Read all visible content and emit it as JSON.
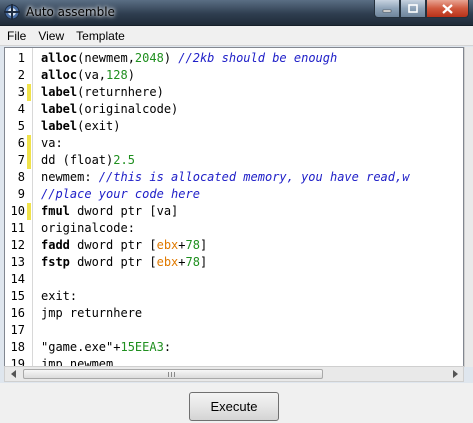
{
  "window": {
    "title": "Auto assemble",
    "icon": "cheat-engine-icon",
    "controls": [
      "minimize-icon",
      "maximize-icon",
      "close-icon"
    ]
  },
  "menu": [
    "File",
    "View",
    "Template"
  ],
  "editor": {
    "lines": [
      {
        "n": "1",
        "marked": false,
        "tokens": [
          {
            "t": "alloc",
            "c": "kw"
          },
          {
            "t": "(newmem,",
            "c": "str"
          },
          {
            "t": "2048",
            "c": "num"
          },
          {
            "t": ") ",
            "c": "str"
          },
          {
            "t": "//2kb should be enough",
            "c": "cmt"
          }
        ]
      },
      {
        "n": "2",
        "marked": false,
        "tokens": [
          {
            "t": "alloc",
            "c": "kw"
          },
          {
            "t": "(va,",
            "c": "str"
          },
          {
            "t": "128",
            "c": "num"
          },
          {
            "t": ")",
            "c": "str"
          }
        ]
      },
      {
        "n": "3",
        "marked": true,
        "tokens": [
          {
            "t": "label",
            "c": "kw"
          },
          {
            "t": "(returnhere)",
            "c": "str"
          }
        ]
      },
      {
        "n": "4",
        "marked": false,
        "tokens": [
          {
            "t": "label",
            "c": "kw"
          },
          {
            "t": "(originalcode)",
            "c": "str"
          }
        ]
      },
      {
        "n": "5",
        "marked": false,
        "tokens": [
          {
            "t": "label",
            "c": "kw"
          },
          {
            "t": "(exit)",
            "c": "str"
          }
        ]
      },
      {
        "n": "6",
        "marked": true,
        "tokens": [
          {
            "t": "va:",
            "c": "str"
          }
        ]
      },
      {
        "n": "7",
        "marked": true,
        "tokens": [
          {
            "t": "dd (float)",
            "c": "str"
          },
          {
            "t": "2.5",
            "c": "num"
          }
        ]
      },
      {
        "n": "8",
        "marked": false,
        "tokens": [
          {
            "t": "newmem: ",
            "c": "str"
          },
          {
            "t": "//this is allocated memory, you have read,w",
            "c": "cmt"
          }
        ]
      },
      {
        "n": "9",
        "marked": false,
        "tokens": [
          {
            "t": "//place your code here",
            "c": "cmt"
          }
        ]
      },
      {
        "n": "10",
        "marked": true,
        "tokens": [
          {
            "t": "fmul",
            "c": "kw"
          },
          {
            "t": " dword ptr [va]",
            "c": "str"
          }
        ]
      },
      {
        "n": "11",
        "marked": false,
        "tokens": [
          {
            "t": "originalcode:",
            "c": "str"
          }
        ]
      },
      {
        "n": "12",
        "marked": false,
        "tokens": [
          {
            "t": "fadd",
            "c": "kw"
          },
          {
            "t": " dword ptr [",
            "c": "str"
          },
          {
            "t": "ebx",
            "c": "reg"
          },
          {
            "t": "+",
            "c": "str"
          },
          {
            "t": "78",
            "c": "num"
          },
          {
            "t": "]",
            "c": "str"
          }
        ]
      },
      {
        "n": "13",
        "marked": false,
        "tokens": [
          {
            "t": "fstp",
            "c": "kw"
          },
          {
            "t": " dword ptr [",
            "c": "str"
          },
          {
            "t": "ebx",
            "c": "reg"
          },
          {
            "t": "+",
            "c": "str"
          },
          {
            "t": "78",
            "c": "num"
          },
          {
            "t": "]",
            "c": "str"
          }
        ]
      },
      {
        "n": "14",
        "marked": false,
        "tokens": []
      },
      {
        "n": "15",
        "marked": false,
        "tokens": [
          {
            "t": "exit:",
            "c": "str"
          }
        ]
      },
      {
        "n": "16",
        "marked": false,
        "tokens": [
          {
            "t": "jmp returnhere",
            "c": "str"
          }
        ]
      },
      {
        "n": "17",
        "marked": false,
        "tokens": []
      },
      {
        "n": "18",
        "marked": false,
        "tokens": [
          {
            "t": "\"game.exe\"",
            "c": "str"
          },
          {
            "t": "+",
            "c": "str"
          },
          {
            "t": "15EEA3",
            "c": "num"
          },
          {
            "t": ":",
            "c": "str"
          }
        ]
      },
      {
        "n": "19",
        "marked": false,
        "tokens": [
          {
            "t": "jmp newmem",
            "c": "str"
          }
        ]
      }
    ]
  },
  "colors": {
    "comment": "#2020c8",
    "number": "#1f8f1f",
    "register": "#e07a00",
    "marker": "#f0e24a"
  },
  "buttons": {
    "execute": "Execute"
  }
}
